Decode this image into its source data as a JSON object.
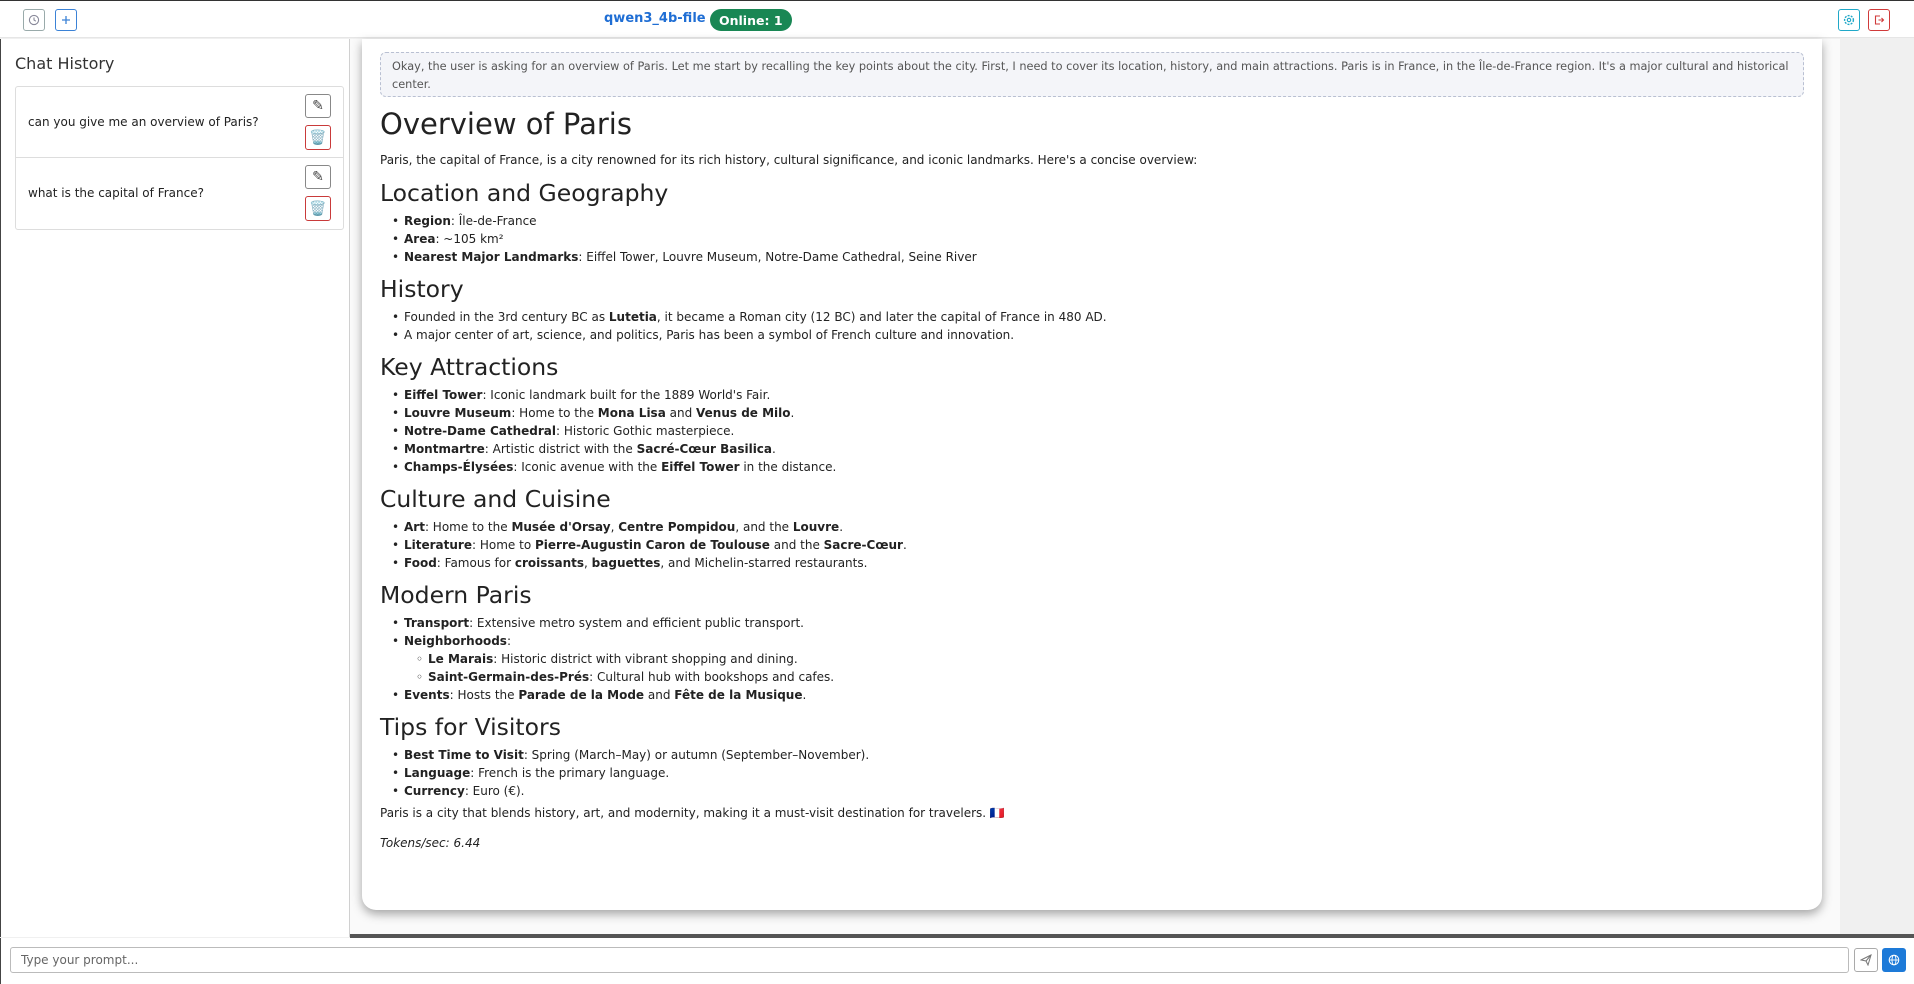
{
  "header": {
    "model_name": "qwen3_4b-file",
    "online_status": "Online: 1",
    "icons": {
      "history": "history-icon",
      "new_chat": "plus-icon",
      "settings": "gear-icon",
      "logout": "logout-icon"
    },
    "colors": {
      "model": "#1f6ed4",
      "online": "#198754",
      "settings": "#20a8c8",
      "logout": "#d03a3a"
    }
  },
  "sidebar": {
    "title": "Chat History",
    "items": [
      {
        "label": "can you give me an overview of Paris?",
        "edit_glyph": "✎",
        "delete_glyph": "🗑️"
      },
      {
        "label": "what is the capital of France?",
        "edit_glyph": "✎",
        "delete_glyph": "🗑️"
      }
    ]
  },
  "message": {
    "thinking": "Okay, the user is asking for an overview of Paris. Let me start by recalling the key points about the city. First, I need to cover its location, history, and main attractions. Paris is in France, in the Île-de-France region. It's a major cultural and historical center.",
    "title": "Overview of Paris",
    "intro": "Paris, the capital of France, is a city renowned for its rich history, cultural significance, and iconic landmarks. Here's a concise overview:",
    "sections": [
      {
        "heading": "Location and Geography",
        "items": [
          {
            "parts": [
              {
                "b": "Region"
              },
              {
                "t": ": Île-de-France"
              }
            ]
          },
          {
            "parts": [
              {
                "b": "Area"
              },
              {
                "t": ": ~105 km²"
              }
            ]
          },
          {
            "parts": [
              {
                "b": "Nearest Major Landmarks"
              },
              {
                "t": ": Eiffel Tower, Louvre Museum, Notre-Dame Cathedral, Seine River"
              }
            ]
          }
        ]
      },
      {
        "heading": "History",
        "items": [
          {
            "parts": [
              {
                "t": "Founded in the 3rd century BC as "
              },
              {
                "b": "Lutetia"
              },
              {
                "t": ", it became a Roman city (12 BC) and later the capital of France in 480 AD."
              }
            ]
          },
          {
            "parts": [
              {
                "t": "A major center of art, science, and politics, Paris has been a symbol of French culture and innovation."
              }
            ]
          }
        ]
      },
      {
        "heading": "Key Attractions",
        "items": [
          {
            "parts": [
              {
                "b": "Eiffel Tower"
              },
              {
                "t": ": Iconic landmark built for the 1889 World's Fair."
              }
            ]
          },
          {
            "parts": [
              {
                "b": "Louvre Museum"
              },
              {
                "t": ": Home to the "
              },
              {
                "b": "Mona Lisa"
              },
              {
                "t": " and "
              },
              {
                "b": "Venus de Milo"
              },
              {
                "t": "."
              }
            ]
          },
          {
            "parts": [
              {
                "b": "Notre-Dame Cathedral"
              },
              {
                "t": ": Historic Gothic masterpiece."
              }
            ]
          },
          {
            "parts": [
              {
                "b": "Montmartre"
              },
              {
                "t": ": Artistic district with the "
              },
              {
                "b": "Sacré-Cœur Basilica"
              },
              {
                "t": "."
              }
            ]
          },
          {
            "parts": [
              {
                "b": "Champs-Élysées"
              },
              {
                "t": ": Iconic avenue with the "
              },
              {
                "b": "Eiffel Tower"
              },
              {
                "t": " in the distance."
              }
            ]
          }
        ]
      },
      {
        "heading": "Culture and Cuisine",
        "items": [
          {
            "parts": [
              {
                "b": "Art"
              },
              {
                "t": ": Home to the "
              },
              {
                "b": "Musée d'Orsay"
              },
              {
                "t": ", "
              },
              {
                "b": "Centre Pompidou"
              },
              {
                "t": ", and the "
              },
              {
                "b": "Louvre"
              },
              {
                "t": "."
              }
            ]
          },
          {
            "parts": [
              {
                "b": "Literature"
              },
              {
                "t": ": Home to "
              },
              {
                "b": "Pierre-Augustin Caron de Toulouse"
              },
              {
                "t": " and the "
              },
              {
                "b": "Sacre-Cœur"
              },
              {
                "t": "."
              }
            ]
          },
          {
            "parts": [
              {
                "b": "Food"
              },
              {
                "t": ": Famous for "
              },
              {
                "b": "croissants"
              },
              {
                "t": ", "
              },
              {
                "b": "baguettes"
              },
              {
                "t": ", and Michelin-starred restaurants."
              }
            ]
          }
        ]
      },
      {
        "heading": "Modern Paris",
        "items": [
          {
            "parts": [
              {
                "b": "Transport"
              },
              {
                "t": ": Extensive metro system and efficient public transport."
              }
            ]
          },
          {
            "parts": [
              {
                "b": "Neighborhoods"
              },
              {
                "t": ":"
              }
            ],
            "children": [
              {
                "parts": [
                  {
                    "b": "Le Marais"
                  },
                  {
                    "t": ": Historic district with vibrant shopping and dining."
                  }
                ]
              },
              {
                "parts": [
                  {
                    "b": "Saint-Germain-des-Prés"
                  },
                  {
                    "t": ": Cultural hub with bookshops and cafes."
                  }
                ]
              }
            ]
          },
          {
            "parts": [
              {
                "b": "Events"
              },
              {
                "t": ": Hosts the "
              },
              {
                "b": "Parade de la Mode"
              },
              {
                "t": " and "
              },
              {
                "b": "Fête de la Musique"
              },
              {
                "t": "."
              }
            ]
          }
        ]
      },
      {
        "heading": "Tips for Visitors",
        "items": [
          {
            "parts": [
              {
                "b": "Best Time to Visit"
              },
              {
                "t": ": Spring (March–May) or autumn (September–November)."
              }
            ]
          },
          {
            "parts": [
              {
                "b": "Language"
              },
              {
                "t": ": French is the primary language."
              }
            ]
          },
          {
            "parts": [
              {
                "b": "Currency"
              },
              {
                "t": ": Euro (€)."
              }
            ]
          }
        ]
      }
    ],
    "closing": "Paris is a city that blends history, art, and modernity, making it a must-visit destination for travelers. 🇫🇷",
    "tokens": "Tokens/sec: 6.44"
  },
  "prompt": {
    "placeholder": "Type your prompt...",
    "value": "",
    "send_icon": "send-icon",
    "web_icon": "globe-icon"
  }
}
